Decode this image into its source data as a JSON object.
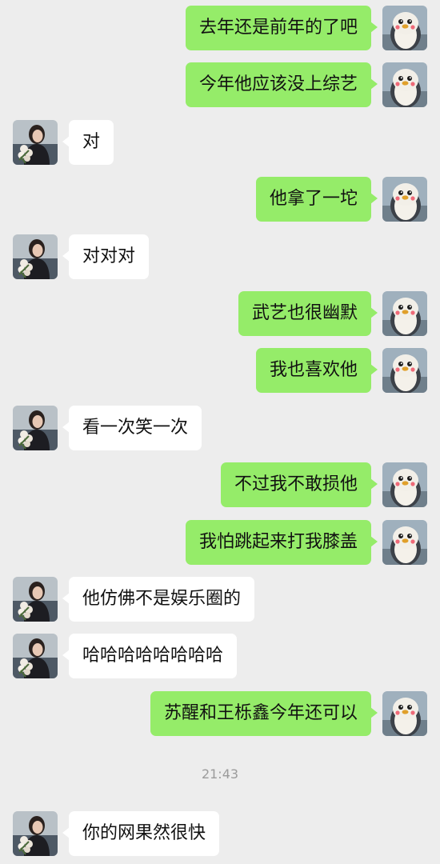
{
  "colors": {
    "background": "#ededed",
    "sent_bubble": "#95ec69",
    "received_bubble": "#ffffff"
  },
  "messages": [
    {
      "side": "right",
      "text": "去年还是前年的了吧",
      "avatar": "penguin-avatar"
    },
    {
      "side": "right",
      "text": "今年他应该没上综艺",
      "avatar": "penguin-avatar"
    },
    {
      "side": "left",
      "text": "对",
      "avatar": "girl-with-flowers-avatar"
    },
    {
      "side": "right",
      "text": "他拿了一坨",
      "avatar": "penguin-avatar"
    },
    {
      "side": "left",
      "text": "对对对",
      "avatar": "girl-with-flowers-avatar"
    },
    {
      "side": "right",
      "text": "武艺也很幽默",
      "avatar": "penguin-avatar"
    },
    {
      "side": "right",
      "text": "我也喜欢他",
      "avatar": "penguin-avatar"
    },
    {
      "side": "left",
      "text": "看一次笑一次",
      "avatar": "girl-with-flowers-avatar"
    },
    {
      "side": "right",
      "text": "不过我不敢损他",
      "avatar": "penguin-avatar"
    },
    {
      "side": "right",
      "text": "我怕跳起来打我膝盖",
      "avatar": "penguin-avatar"
    },
    {
      "side": "left",
      "text": "他仿佛不是娱乐圈的",
      "avatar": "girl-with-flowers-avatar"
    },
    {
      "side": "left",
      "text": "哈哈哈哈哈哈哈哈",
      "avatar": "girl-with-flowers-avatar"
    },
    {
      "side": "right",
      "text": "苏醒和王栎鑫今年还可以",
      "avatar": "penguin-avatar"
    },
    {
      "side": "left",
      "text": "你的网果然很快",
      "avatar": "girl-with-flowers-avatar"
    }
  ],
  "timestamp": "21:43"
}
